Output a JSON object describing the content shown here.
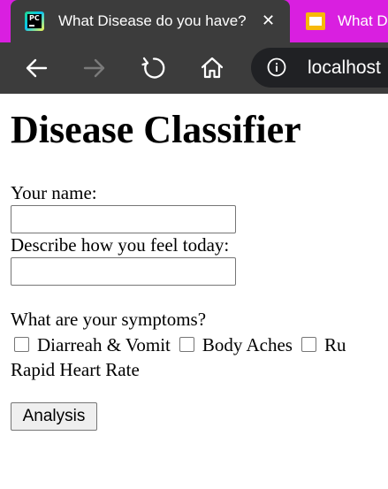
{
  "browser": {
    "active_tab": {
      "title": "What Disease do you have?",
      "favicon": "pycharm-icon"
    },
    "inactive_tab": {
      "title": "What D",
      "favicon": "slides-icon"
    },
    "address_bar": {
      "url": "localhost"
    },
    "colors": {
      "tab_strip": "#d91fe0",
      "toolbar": "#3c3c3c",
      "omnibox": "#202124"
    }
  },
  "page": {
    "title": "Disease Classifier",
    "name_label": "Your name:",
    "name_value": "",
    "feel_label": "Describe how you feel today:",
    "feel_value": "",
    "symptoms_label": "What are your symptoms?",
    "symptoms": [
      {
        "label": "Diarreah & Vomit",
        "checked": false
      },
      {
        "label": "Body Aches",
        "checked": false
      },
      {
        "label": "Ru",
        "checked": false
      },
      {
        "label": "Rapid Heart Rate",
        "checked": false
      }
    ],
    "submit_label": "Analysis"
  }
}
